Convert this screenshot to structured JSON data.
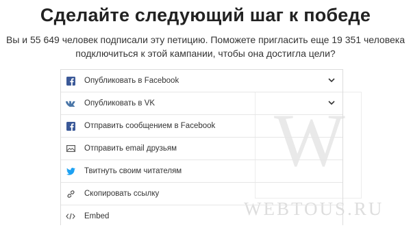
{
  "heading": "Сделайте следующий шаг к победе",
  "subtitle_line1": "Вы и 55 649 человек подписали эту петицию. Поможете пригласить еще 19 351 человека",
  "subtitle_line2": "подключиться к этой кампании, чтобы она достигла цели?",
  "share_options": [
    {
      "label": "Опубликовать в Facebook",
      "icon": "facebook-icon"
    },
    {
      "label": "Опубликовать в VK",
      "icon": "vk-icon"
    },
    {
      "label": "Отправить сообщением в Facebook",
      "icon": "facebook-icon"
    },
    {
      "label": "Отправить email друзьям",
      "icon": "email-icon"
    },
    {
      "label": "Твитнуть своим читателям",
      "icon": "twitter-icon"
    },
    {
      "label": "Скопировать ссылку",
      "icon": "link-icon"
    },
    {
      "label": "Embed",
      "icon": "embed-icon"
    }
  ],
  "colors": {
    "facebook": "#3b5998",
    "vk": "#4a76a8",
    "twitter": "#1da1f2",
    "icon_gray": "#555555"
  },
  "watermark": {
    "letter": "W",
    "text": "WEBTOUS.RU"
  }
}
